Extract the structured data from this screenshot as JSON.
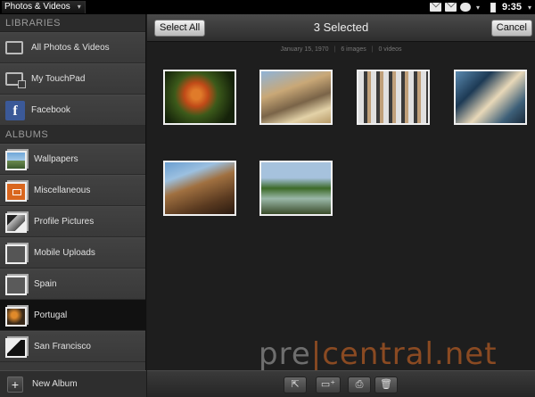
{
  "statusbar": {
    "app_title": "Photos & Videos",
    "clock": "9:35",
    "icons": [
      "mail-icon",
      "mail-icon",
      "chat-icon",
      "battery-icon"
    ]
  },
  "sidebar": {
    "libraries_header": "LIBRARIES",
    "libraries": [
      {
        "label": "All Photos & Videos",
        "icon": "photos-icon"
      },
      {
        "label": "My TouchPad",
        "icon": "touchpad-icon"
      },
      {
        "label": "Facebook",
        "icon": "facebook-icon",
        "icon_glyph": "f"
      }
    ],
    "albums_header": "ALBUMS",
    "albums": [
      {
        "label": "Wallpapers"
      },
      {
        "label": "Miscellaneous"
      },
      {
        "label": "Profile Pictures"
      },
      {
        "label": "Mobile Uploads"
      },
      {
        "label": "Spain"
      },
      {
        "label": "Portugal",
        "selected": true
      },
      {
        "label": "San Francisco"
      }
    ],
    "new_album_label": "New Album",
    "new_album_glyph": "+"
  },
  "toolbar": {
    "select_all_label": "Select All",
    "title": "3 Selected",
    "cancel_label": "Cancel"
  },
  "meta": {
    "date": "January 15, 1970",
    "images": "6 images",
    "videos": "0 videos"
  },
  "photos_count": 6,
  "watermark": {
    "part1": "pre",
    "separator": "|",
    "part2": "central.net"
  },
  "bottom_toolbar": {
    "buttons": [
      "share-icon",
      "add-to-folder-icon",
      "print-icon",
      "trash-icon"
    ]
  }
}
